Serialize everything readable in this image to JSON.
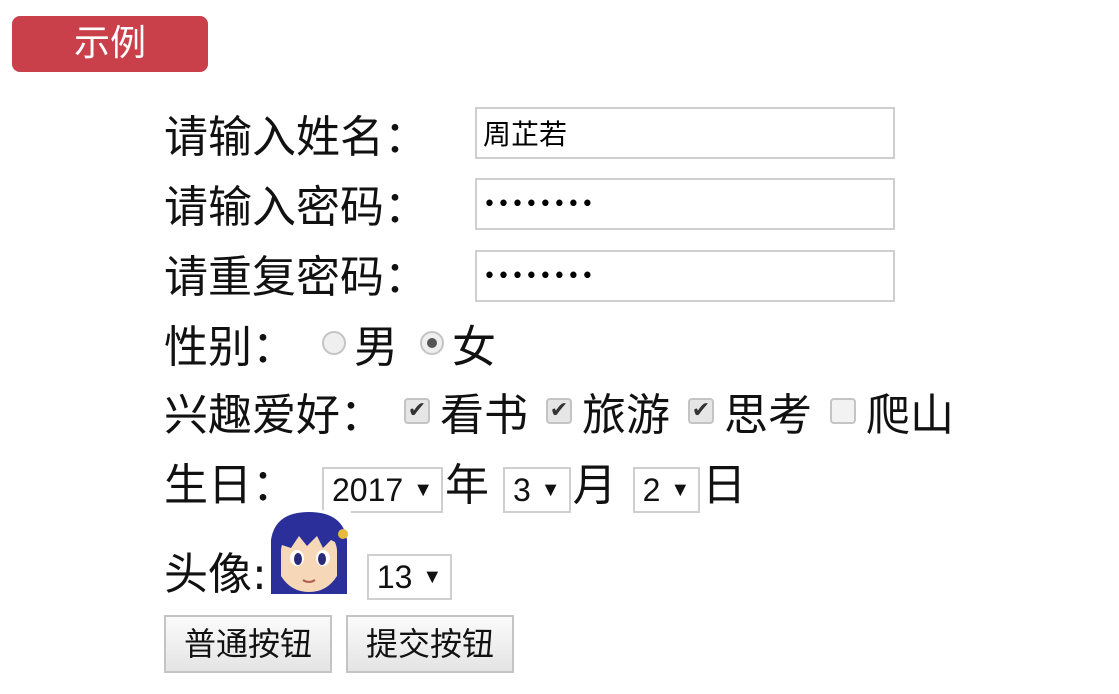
{
  "badge": {
    "label": "示例"
  },
  "form": {
    "name": {
      "label": "请输入姓名：",
      "value": "周芷若"
    },
    "password": {
      "label": "请输入密码：",
      "value": "••••••••"
    },
    "confirm": {
      "label": "请重复密码：",
      "value": "••••••••"
    },
    "gender": {
      "label": "性别：",
      "options": [
        {
          "label": "男",
          "checked": false
        },
        {
          "label": "女",
          "checked": true
        }
      ]
    },
    "hobbies": {
      "label": "兴趣爱好：",
      "options": [
        {
          "label": "看书",
          "checked": true
        },
        {
          "label": "旅游",
          "checked": true
        },
        {
          "label": "思考",
          "checked": true
        },
        {
          "label": "爬山",
          "checked": false
        }
      ]
    },
    "birthday": {
      "label": "生日：",
      "year": "2017",
      "year_unit": "年",
      "month": "3",
      "month_unit": "月",
      "day": "2",
      "day_unit": "日"
    },
    "avatar": {
      "label": "头像:",
      "select_value": "13"
    },
    "buttons": {
      "normal": "普通按钮",
      "submit": "提交按钮"
    }
  },
  "colors": {
    "badge": "#c9404b"
  }
}
